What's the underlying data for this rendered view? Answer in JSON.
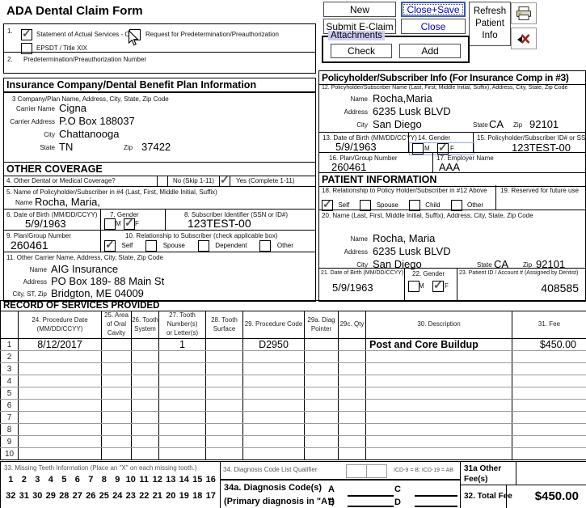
{
  "title": "ADA Dental Claim Form",
  "toolbar": {
    "new": "New",
    "close_save": "Close+Save",
    "submit_eclaim": "Submit E-Claim",
    "close": "Close",
    "refresh_patient_info": "Refresh Patient Info",
    "attachments": "Attachments",
    "check": "Check",
    "add": "Add"
  },
  "section1": {
    "num": "1.",
    "opt_statement": "Statement of Actual Services  - OR -",
    "opt_statement_checked": true,
    "opt_request": "Request for Predetermination/Preauthorization",
    "opt_request_checked": false,
    "opt_epsdt": "EPSDT / Title XIX",
    "opt_epsdt_checked": false
  },
  "section2": {
    "num": "2.",
    "label": "Predetermination/Preauthorization Number"
  },
  "insurance": {
    "header": "Insurance Company/Dental Benefit Plan Information",
    "item_label": "3   Company/Plan Name, Address, City, State, Zip Code",
    "carrier_name_label": "Carrier Name",
    "carrier_name": "Cigna",
    "carrier_address_label": "Carrier Address",
    "carrier_address": "P.O Box 188037",
    "city_label": "City",
    "city": "Chattanooga",
    "state_label": "State",
    "state": "TN",
    "zip_label": "Zip",
    "zip": "37422"
  },
  "other_coverage": {
    "header": "OTHER COVERAGE",
    "q4": {
      "label": "4.  Other Dental or Medical Coverage?",
      "no_label": "No (Skip 1-11)",
      "no_checked": false,
      "yes_label": "Yes (Complete 1-11)",
      "yes_checked": true
    },
    "q5": {
      "label": "5. Name of Policyholder/Subscriber in #4 (Last, First, Middle Initial, Suffix)",
      "name_label": "Name",
      "name": "Rocha, Maria,"
    },
    "q6": {
      "label": "6. Date of Birth (MM/DD/CCYY)",
      "value": "5/9/1963"
    },
    "q7": {
      "label": "7. Gender",
      "m_label": "M",
      "m_checked": false,
      "f_label": "F",
      "f_checked": true
    },
    "q8": {
      "label": "8. Subscriber Identifier (SSN or ID#)",
      "value": "123TEST-00"
    },
    "q9": {
      "label": "9. Plan/Group Number",
      "value": "260461"
    },
    "q10": {
      "label": "10. Relationship to Subscriber (check applicable box)",
      "options": [
        {
          "label": "Self",
          "checked": true
        },
        {
          "label": "Spouse",
          "checked": false
        },
        {
          "label": "Dependent",
          "checked": false
        },
        {
          "label": "Other",
          "checked": false
        }
      ]
    },
    "q11": {
      "label": "11. Other Carrier Name, Address, City, State, Zip Code",
      "name_label": "Name",
      "name": "AIG Insurance",
      "address_label": "Address",
      "address": "PO Box 189- 88 Main St",
      "city_label": "City, ST, Zip",
      "city": "Bridgton, ME  04009"
    }
  },
  "policyholder": {
    "header": "Policyholder/Subscriber Info (For Insurance Comp in #3)",
    "q12": {
      "label": "12. Policyholder/Subscriber Name (Last, First, Middle Initial, Suffix), Address, City, State, Zip Code",
      "name_label": "Name",
      "name": "Rocha,Maria",
      "address_label": "Address",
      "address": "6235 Lusk BLVD",
      "city_label": "City",
      "city": "San Diego",
      "state_label": "State",
      "state": "CA",
      "zip_label": "Zip",
      "zip": "92101"
    },
    "q13": {
      "label": "13. Date of Birth (MM/DD/CCYY)",
      "value": "5/9/1963"
    },
    "q14": {
      "label": "14. Gender",
      "m_label": "M",
      "m_checked": false,
      "f_label": "F",
      "f_checked": true
    },
    "q15": {
      "label": "15. Policyholder/Subscriber ID# or SSN#",
      "value": "123TEST-00"
    },
    "q16": {
      "label": "16. Plan/Group Number",
      "value": "260461"
    },
    "q17": {
      "label": "17. Employer Name",
      "value": "AAA"
    }
  },
  "patient": {
    "header": "PATIENT INFORMATION",
    "q18": {
      "label": "18. Relationship to Policy Holder/Subscriber in #12 Above",
      "options": [
        {
          "label": "Self",
          "checked": true
        },
        {
          "label": "Spouse",
          "checked": false
        },
        {
          "label": "Child",
          "checked": false
        },
        {
          "label": "Other",
          "checked": false
        }
      ]
    },
    "q19": {
      "label": "19. Reserved for future use"
    },
    "q20": {
      "label": "20. Name (Last, First, Middle Initial, Suffix), Address, City, State, Zip Code",
      "name_label": "Name",
      "name": "Rocha, Maria",
      "address_label": "Address",
      "address": "6235 Lusk BLVD",
      "city_label": "City",
      "city": "San Diego",
      "state_label": "State",
      "state": "CA",
      "zip_label": "Zip",
      "zip": "92101"
    },
    "q21": {
      "label": "21. Date of Birth (MM/DD/CCYY)",
      "value": "5/9/1963"
    },
    "q22": {
      "label": "22. Gender",
      "m_label": "M",
      "m_checked": false,
      "f_label": "F",
      "f_checked": true
    },
    "q23": {
      "label": "23. Patient ID / Account # (Assigned by Dentist)",
      "value": "408585"
    }
  },
  "services": {
    "header": "RECORD OF SERVICES PROVIDED",
    "columns": [
      "",
      "24. Procedure Date\n(MM/DD/CCYY)",
      "25. Area\nof Oral\nCavity",
      "26. Tooth\nSystem",
      "27. Tooth Number(s)\nor Letter(s)",
      "28. Tooth\nSurface",
      "29. Procedure Code",
      "29a. Diag\nPointer",
      "29c. Qty",
      "30. Description",
      "31. Fee"
    ],
    "rows": [
      {
        "n": "1",
        "date": "8/12/2017",
        "area": "",
        "system": "",
        "tooth": "1",
        "surface": "",
        "code": "D2950",
        "diag": "",
        "qty": "",
        "desc": "Post and Core Buildup",
        "fee": "$450.00"
      },
      {
        "n": "2",
        "date": "",
        "area": "",
        "system": "",
        "tooth": "",
        "surface": "",
        "code": "",
        "diag": "",
        "qty": "",
        "desc": "",
        "fee": ""
      },
      {
        "n": "3",
        "date": "",
        "area": "",
        "system": "",
        "tooth": "",
        "surface": "",
        "code": "",
        "diag": "",
        "qty": "",
        "desc": "",
        "fee": ""
      },
      {
        "n": "4",
        "date": "",
        "area": "",
        "system": "",
        "tooth": "",
        "surface": "",
        "code": "",
        "diag": "",
        "qty": "",
        "desc": "",
        "fee": ""
      },
      {
        "n": "5",
        "date": "",
        "area": "",
        "system": "",
        "tooth": "",
        "surface": "",
        "code": "",
        "diag": "",
        "qty": "",
        "desc": "",
        "fee": ""
      },
      {
        "n": "6",
        "date": "",
        "area": "",
        "system": "",
        "tooth": "",
        "surface": "",
        "code": "",
        "diag": "",
        "qty": "",
        "desc": "",
        "fee": ""
      },
      {
        "n": "7",
        "date": "",
        "area": "",
        "system": "",
        "tooth": "",
        "surface": "",
        "code": "",
        "diag": "",
        "qty": "",
        "desc": "",
        "fee": ""
      },
      {
        "n": "8",
        "date": "",
        "area": "",
        "system": "",
        "tooth": "",
        "surface": "",
        "code": "",
        "diag": "",
        "qty": "",
        "desc": "",
        "fee": ""
      },
      {
        "n": "9",
        "date": "",
        "area": "",
        "system": "",
        "tooth": "",
        "surface": "",
        "code": "",
        "diag": "",
        "qty": "",
        "desc": "",
        "fee": ""
      },
      {
        "n": "10",
        "date": "",
        "area": "",
        "system": "",
        "tooth": "",
        "surface": "",
        "code": "",
        "diag": "",
        "qty": "",
        "desc": "",
        "fee": ""
      }
    ]
  },
  "bottom": {
    "missing_teeth": {
      "label": "33. Missing Teeth Information (Place an \"X\" on each missing tooth.)",
      "row1": [
        "1",
        "2",
        "3",
        "4",
        "5",
        "6",
        "7",
        "8",
        "9",
        "10",
        "11",
        "12",
        "13",
        "14",
        "15",
        "16"
      ],
      "row2": [
        "32",
        "31",
        "30",
        "29",
        "28",
        "27",
        "26",
        "25",
        "24",
        "23",
        "22",
        "21",
        "20",
        "19",
        "18",
        "17"
      ]
    },
    "diagnosis": {
      "qualifier_label": "34. Diagnosis Code List Qualifier",
      "icd_note": "ICD-9 = B; ICD-19 = AB",
      "codes_label": "34a. Diagnosis Code(s)",
      "codes_sub": "(Primary diagnosis in \"A\")",
      "letters": [
        "A",
        "B",
        "C",
        "D"
      ]
    },
    "fees": {
      "other_label": "31a Other\nFee(s)",
      "total_label": "32. Total Fee",
      "total_value": "$450.00"
    }
  }
}
